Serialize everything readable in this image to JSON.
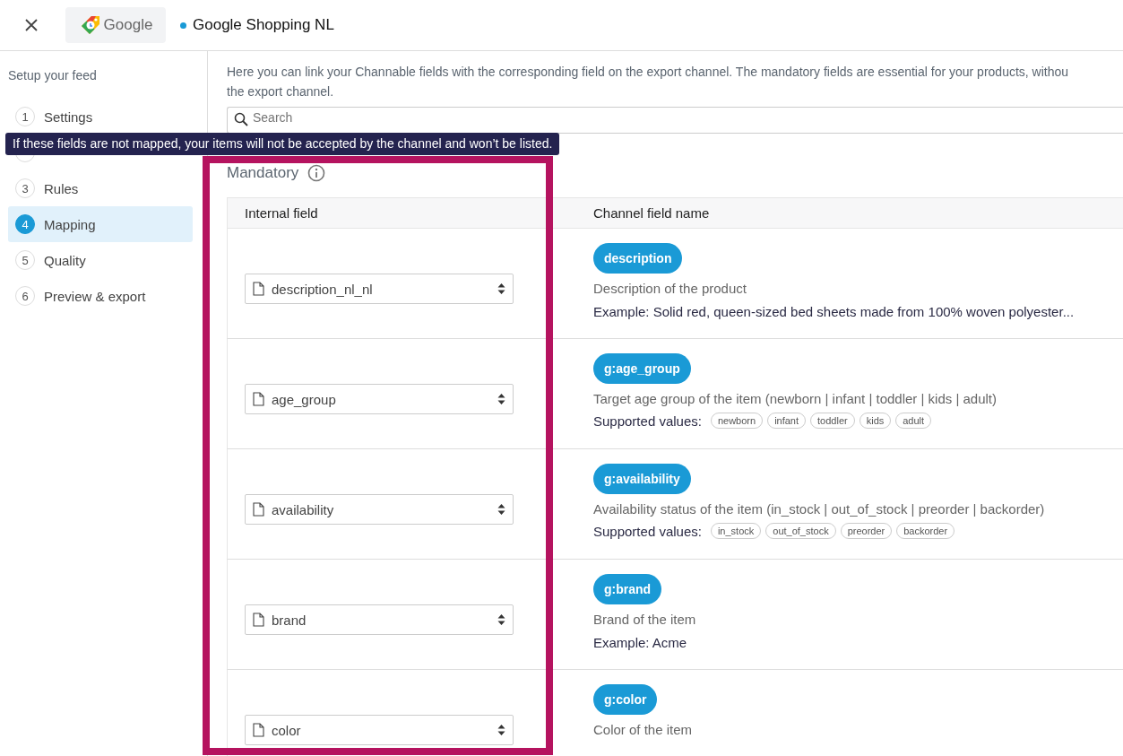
{
  "header": {
    "logo_text": "Google",
    "title": "Google Shopping NL"
  },
  "sidebar": {
    "heading": "Setup your feed",
    "steps": [
      {
        "number": "1",
        "label": "Settings",
        "selected": false
      },
      {
        "selected": false
      },
      {
        "number": "3",
        "label": "Rules",
        "selected": false
      },
      {
        "number": "4",
        "label": "Mapping",
        "selected": true
      },
      {
        "number": "5",
        "label": "Quality",
        "selected": false
      },
      {
        "number": "6",
        "label": "Preview & export",
        "selected": false
      }
    ]
  },
  "intro_lines": [
    "Here you can link your Channable fields with the corresponding field on the export channel. The mandatory fields are essential for your products, withou",
    "the export channel."
  ],
  "search": {
    "placeholder": "Search"
  },
  "tooltip": "If these fields are not mapped, your items will not be accepted by the channel and won’t be listed.",
  "section_title": "Mandatory",
  "table": {
    "columns": [
      "Internal field",
      "Channel field name"
    ],
    "rows": [
      {
        "internal": "description_nl_nl",
        "channel_field": "description",
        "description": "Description of the product",
        "example": "Example: Solid red, queen-sized bed sheets made from 100% woven polyester..."
      },
      {
        "internal": "age_group",
        "channel_field": "g:age_group",
        "description": "Target age group of the item (newborn | infant | toddler | kids | adult)",
        "supported_label": "Supported values:",
        "supported_values": [
          "newborn",
          "infant",
          "toddler",
          "kids",
          "adult"
        ]
      },
      {
        "internal": "availability",
        "channel_field": "g:availability",
        "description": "Availability status of the item (in_stock | out_of_stock | preorder | backorder)",
        "supported_label": "Supported values:",
        "supported_values": [
          "in_stock",
          "out_of_stock",
          "preorder",
          "backorder"
        ]
      },
      {
        "internal": "brand",
        "channel_field": "g:brand",
        "description": "Brand of the item",
        "example": "Example: Acme"
      },
      {
        "internal": "color",
        "channel_field": "g:color",
        "description": "Color of the item"
      }
    ]
  }
}
